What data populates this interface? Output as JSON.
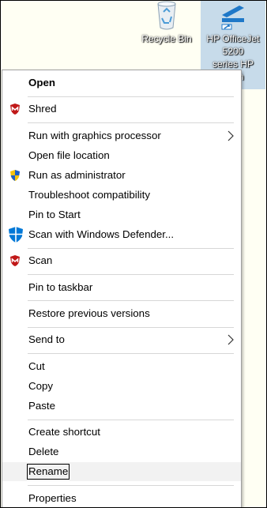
{
  "desktop": {
    "recycle_bin": {
      "label": "Recycle Bin",
      "icon": "recycle-bin-icon"
    },
    "hp_shortcut": {
      "label_lines": [
        "HP OfficeJet",
        "5200",
        "series HP",
        "Scan"
      ],
      "icon": "hp-scanner-icon"
    }
  },
  "menu": {
    "items": [
      {
        "label": "Open"
      },
      {
        "label": "Shred",
        "icon": "mcafee-shield-icon"
      },
      {
        "label": "Run with graphics processor",
        "submenu": true
      },
      {
        "label": "Open file location"
      },
      {
        "label": "Run as administrator",
        "icon": "uac-shield-icon"
      },
      {
        "label": "Troubleshoot compatibility"
      },
      {
        "label": "Pin to Start"
      },
      {
        "label": "Scan with Windows Defender...",
        "icon": "windows-defender-icon"
      },
      {
        "label": "Scan",
        "icon": "mcafee-shield-icon"
      },
      {
        "label": "Pin to taskbar"
      },
      {
        "label": "Restore previous versions"
      },
      {
        "label": "Send to",
        "submenu": true
      },
      {
        "label": "Cut"
      },
      {
        "label": "Copy"
      },
      {
        "label": "Paste"
      },
      {
        "label": "Create shortcut"
      },
      {
        "label": "Delete"
      },
      {
        "label": "Rename",
        "state": "highlighted"
      },
      {
        "label": "Properties"
      }
    ]
  },
  "colors": {
    "desktop": "#fffff3",
    "selection": "#c7dbea",
    "mcafee_red": "#c01818",
    "defender_blue": "#0078d7"
  }
}
